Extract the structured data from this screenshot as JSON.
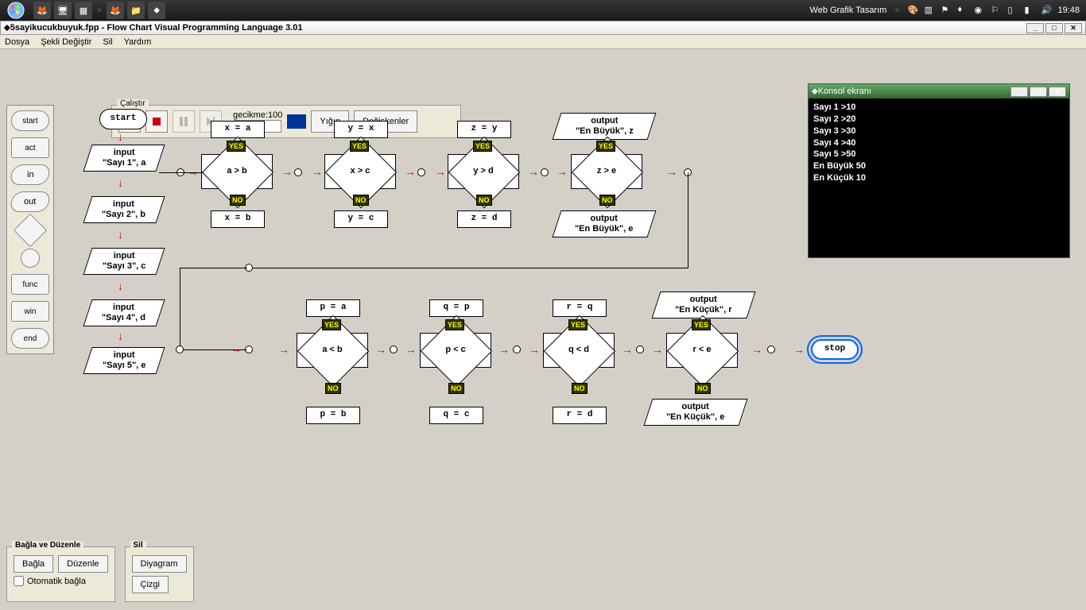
{
  "taskbar": {
    "web": "Web Grafik Tasarım",
    "clock": "19:48"
  },
  "window": {
    "title": "5sayikucukbuyuk.fpp - Flow Chart Visual Programming Language 3.01"
  },
  "menu": {
    "dosya": "Dosya",
    "sekli": "Şekli Değiştir",
    "sil": "Sil",
    "yardim": "Yardım"
  },
  "toolbox": {
    "start": "start",
    "act": "act",
    "in": "in",
    "out": "out",
    "func": "func",
    "win": "win",
    "end": "end"
  },
  "run": {
    "legend": "Çalıştır",
    "delay_label": "gecikme:",
    "delay_value": "100",
    "yigin": "Yığın",
    "degis": "Değişkenler"
  },
  "flow": {
    "start": "start",
    "stop": "stop",
    "in1": "input\n\"Sayı 1\", a",
    "in2": "input\n\"Sayı 2\", b",
    "in3": "input\n\"Sayı 3\", c",
    "in4": "input\n\"Sayı 4\", d",
    "in5": "input\n\"Sayı 5\", e",
    "xa": "x = a",
    "xb": "x = b",
    "yx": "y = x",
    "yc": "y = c",
    "zy": "z = y",
    "zd": "z = d",
    "ab": "a > b",
    "xc": "x > c",
    "yd": "y > d",
    "ze": "z > e",
    "outbz": "output\n\"En Büyük\", z",
    "outbe": "output\n\"En Büyük\", e",
    "pa": "p = a",
    "pb": "p = b",
    "qp": "q = p",
    "qc": "q = c",
    "rq": "r = q",
    "rd": "r = d",
    "alb": "a < b",
    "plc": "p < c",
    "qld": "q < d",
    "rle": "r < e",
    "outkr": "output\n\"En Küçük\", r",
    "outke": "output\n\"En Küçük\", e",
    "yes": "YES",
    "no": "NO"
  },
  "console": {
    "title": "Konsol ekranı",
    "lines": [
      "Sayı 1 >10",
      "Sayı 2 >20",
      "Sayı 3 >30",
      "Sayı 4 >40",
      "Sayı 5 >50",
      "En Büyük 50",
      "En Küçük 10"
    ]
  },
  "bottom": {
    "bagla_legend": "Bağla ve Düzenle",
    "bagla": "Bağla",
    "duzenle": "Düzenle",
    "oto": "Otomatik bağla",
    "sil_legend": "Sil",
    "diyagram": "Diyagram",
    "cizgi": "Çizgi"
  }
}
